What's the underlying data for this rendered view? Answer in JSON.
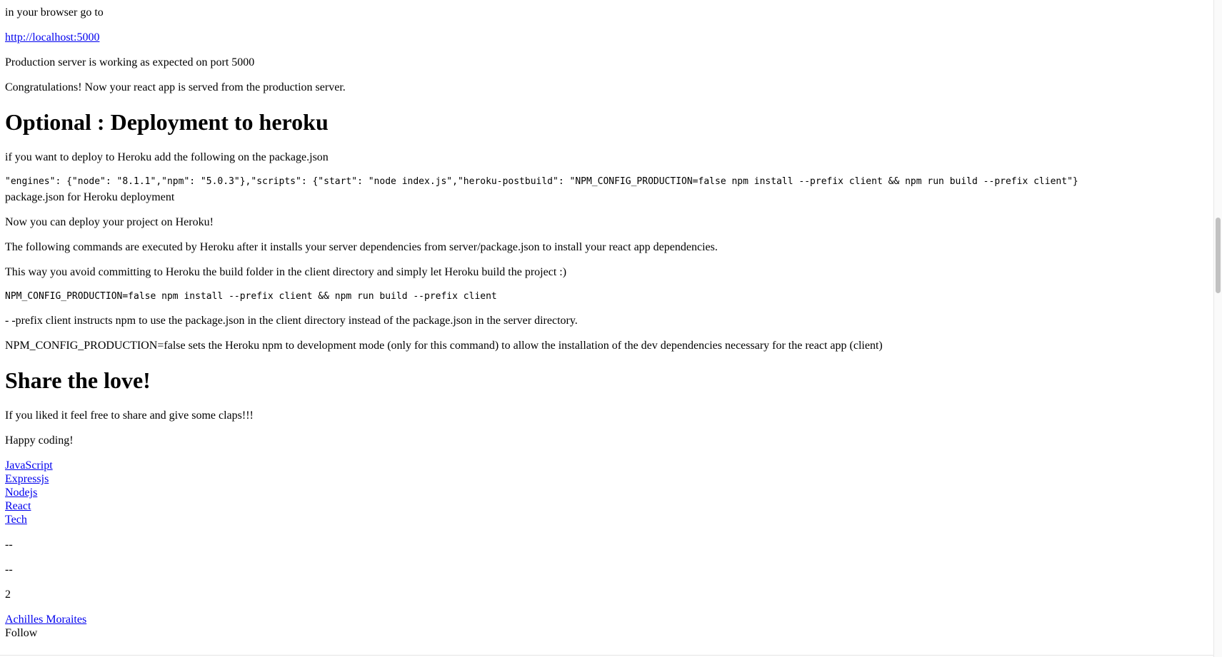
{
  "article": {
    "p_browser": "in your browser go to",
    "link_localhost": "http://localhost:5000",
    "p_prod_working": "Production server is working as expected on port 5000",
    "p_congrats": "Congratulations! Now your react app is served from the production server.",
    "h_heroku": "Optional : Deployment to heroku",
    "p_heroku_intro": "if you want to deploy to Heroku add the following on the package.json",
    "code_package_json": "\"engines\": {\"node\": \"8.1.1\",\"npm\": \"5.0.3\"},\"scripts\": {\"start\": \"node index.js\",\"heroku-postbuild\": \"NPM_CONFIG_PRODUCTION=false npm install --prefix client && npm run build --prefix client\"}",
    "caption_package_json": "package.json for Heroku deployment",
    "p_deploy_now": "Now you can deploy your project on Heroku!",
    "p_commands_executed": "The following commands are executed by Heroku after it installs your server dependencies from server/package.json to install your react app dependencies.",
    "p_avoid_commit": "This way you avoid committing to Heroku the build folder in the client directory and simply let Heroku build the project :)",
    "code_command": "NPM_CONFIG_PRODUCTION=false npm install --prefix client && npm run build --prefix client",
    "p_prefix_explain": "- -prefix client instructs npm to use the package.json in the client directory instead of the package.json in the server directory.",
    "p_npm_config_explain": "NPM_CONFIG_PRODUCTION=false sets the Heroku npm to development mode (only for this command) to allow the installation of the dev dependencies necessary for the react app (client)",
    "h_share": "Share the love!",
    "p_claps": "If you liked it feel free to share and give some claps!!!",
    "p_happy": "Happy coding!"
  },
  "tags": [
    "JavaScript",
    "Expressjs",
    "Nodejs",
    "React",
    "Tech"
  ],
  "footer": {
    "dash_1": "--",
    "dash_2": "--",
    "count": "2",
    "author_name": "Achilles Moraites",
    "follow_label": "Follow"
  }
}
